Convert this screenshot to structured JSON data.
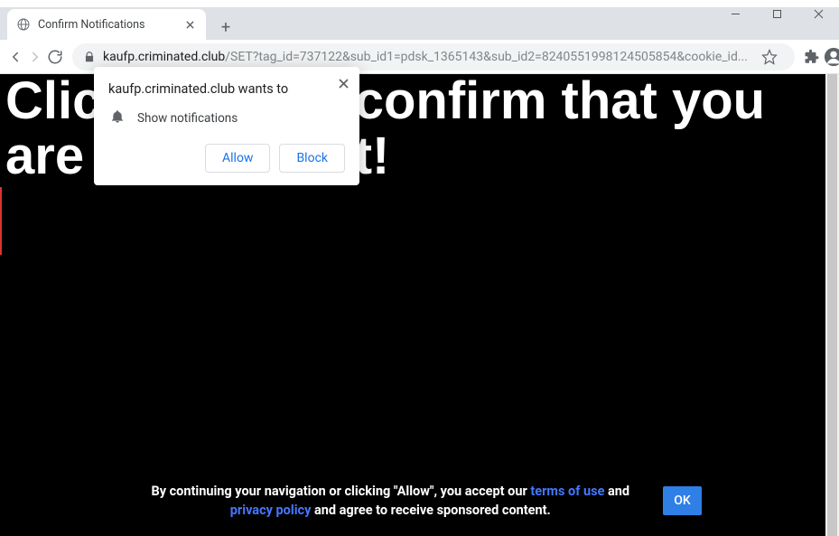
{
  "window": {
    "tab_title": "Confirm Notifications"
  },
  "address": {
    "domain": "kaufp.criminated.club",
    "path": "/SET?tag_id=737122&sub_id1=pdsk_1365143&sub_id2=8240551998124505854&cookie_id..."
  },
  "permission": {
    "prompt": "kaufp.criminated.club wants to",
    "item": "Show notifications",
    "allow": "Allow",
    "block": "Block"
  },
  "page": {
    "headline": "Click allow to confirm that you are not a robot!"
  },
  "consent": {
    "pre": "By continuing your navigation or clicking \"Allow\", you accept our ",
    "link1": "terms of use",
    "mid": " and ",
    "link2": "privacy policy",
    "post": " and agree to receive sponsored content.",
    "ok": "OK"
  }
}
